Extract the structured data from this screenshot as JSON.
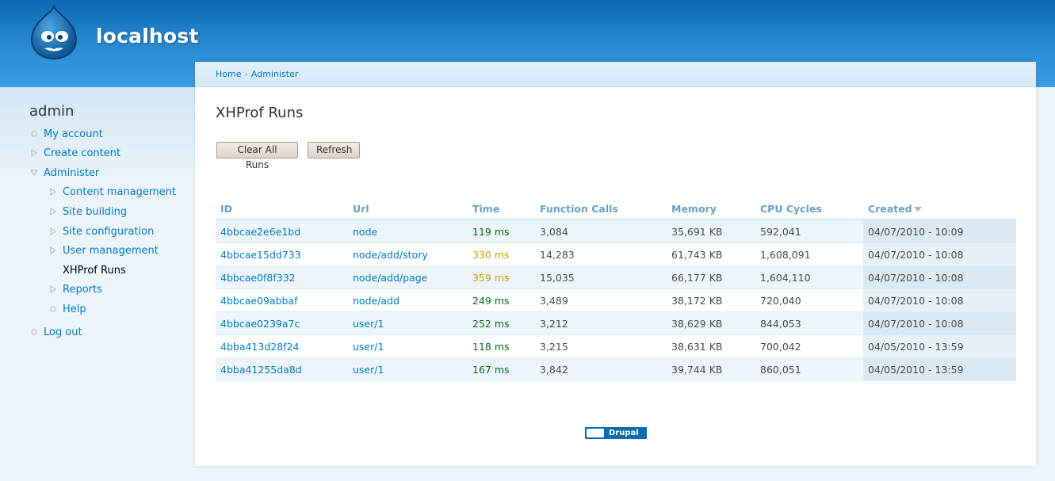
{
  "header": {
    "site_name": "localhost"
  },
  "sidebar": {
    "title": "admin",
    "items": [
      {
        "label": "My account",
        "bullet": "circle"
      },
      {
        "label": "Create content",
        "bullet": "triangle-right"
      },
      {
        "label": "Administer",
        "bullet": "triangle-down"
      },
      {
        "label": "Content management",
        "bullet": "triangle-right"
      },
      {
        "label": "Site building",
        "bullet": "triangle-right"
      },
      {
        "label": "Site configuration",
        "bullet": "triangle-right"
      },
      {
        "label": "User management",
        "bullet": "triangle-right"
      },
      {
        "label": "XHProf Runs",
        "bullet": "circle-filled"
      },
      {
        "label": "Reports",
        "bullet": "triangle-right"
      },
      {
        "label": "Help",
        "bullet": "circle"
      },
      {
        "label": "Log out",
        "bullet": "circle"
      }
    ]
  },
  "breadcrumb": {
    "home": "Home",
    "separator": "›",
    "administer": "Administer"
  },
  "main": {
    "title": "XHProf Runs",
    "buttons": {
      "clear": "Clear All Runs",
      "refresh": "Refresh"
    },
    "table": {
      "headers": [
        "ID",
        "Url",
        "Time",
        "Function Calls",
        "Memory",
        "CPU Cycles",
        "Created"
      ],
      "rows": [
        {
          "id": "4bbcae2e6e1bd",
          "url": "node",
          "time": "119 ms",
          "time_color": "green",
          "calls": "3,084",
          "memory": "35,691 KB",
          "cpu": "592,041",
          "created": "04/07/2010 - 10:09"
        },
        {
          "id": "4bbcae15dd733",
          "url": "node/add/story",
          "time": "330 ms",
          "time_color": "yellow",
          "calls": "14,283",
          "memory": "61,743 KB",
          "cpu": "1,608,091",
          "created": "04/07/2010 - 10:08"
        },
        {
          "id": "4bbcae0f8f332",
          "url": "node/add/page",
          "time": "359 ms",
          "time_color": "yellow",
          "calls": "15,035",
          "memory": "66,177 KB",
          "cpu": "1,604,110",
          "created": "04/07/2010 - 10:08"
        },
        {
          "id": "4bbcae09abbaf",
          "url": "node/add",
          "time": "249 ms",
          "time_color": "green",
          "calls": "3,489",
          "memory": "38,172 KB",
          "cpu": "720,040",
          "created": "04/07/2010 - 10:08"
        },
        {
          "id": "4bbcae0239a7c",
          "url": "user/1",
          "time": "252 ms",
          "time_color": "green",
          "calls": "3,212",
          "memory": "38,629 KB",
          "cpu": "844,053",
          "created": "04/07/2010 - 10:08"
        },
        {
          "id": "4bba413d28f24",
          "url": "user/1",
          "time": "118 ms",
          "time_color": "green",
          "calls": "3,215",
          "memory": "38,631 KB",
          "cpu": "700,042",
          "created": "04/05/2010 - 13:59"
        },
        {
          "id": "4bba41255da8d",
          "url": "user/1",
          "time": "167 ms",
          "time_color": "green",
          "calls": "3,842",
          "memory": "39,744 KB",
          "cpu": "860,051",
          "created": "04/05/2010 - 13:59"
        }
      ]
    }
  },
  "footer": {
    "powered_by": "Drupal"
  },
  "colors": {
    "link": "#027ac6",
    "time_green": "#0a6b1c",
    "time_yellow": "#c9a106",
    "header_blue": "#0c69b3"
  }
}
